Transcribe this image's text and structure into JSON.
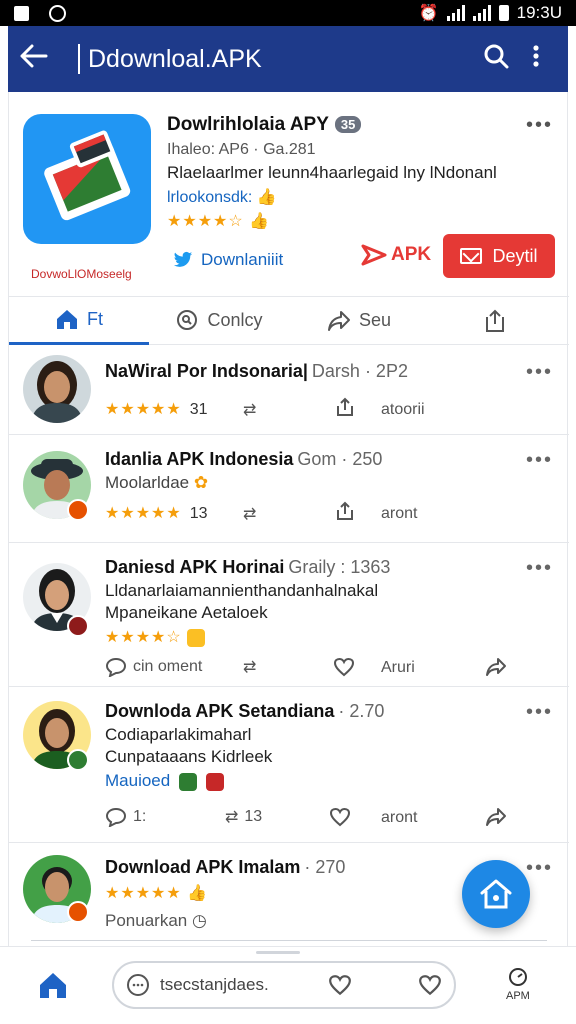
{
  "status_bar": {
    "time": "19:3U"
  },
  "app_bar": {
    "title": "Ddownloal.APK"
  },
  "app_card": {
    "name": "Dowlrihlolaia APY",
    "version_pill": "35",
    "meta": "Ihaleo: AP6 · Ga.281",
    "description": "Rlaelaarlmer leunn4haarlegaid lny lNdonanl",
    "developer": "lrlookonsdk:",
    "rating_stars": "★★★★☆",
    "logo_label": "DovwoLlOMoseelg",
    "twitter_label": "Downlaniiit",
    "apk_label": "APK",
    "deyti_label": "Deytil"
  },
  "tabs": [
    {
      "label": "Ft"
    },
    {
      "label": "Conlcy"
    },
    {
      "label": "Seu"
    },
    {
      "label": ""
    }
  ],
  "posts": [
    {
      "title": "NaWiral Por Indsonaria|",
      "time": "Darsh · 2P2",
      "stars": "★★★★★",
      "count": "31",
      "action3": "atoorii"
    },
    {
      "title": "Idanlia APK Indonesia",
      "time": "Gom · 250",
      "line1": "Moolarldae",
      "stars": "★★★★★",
      "count": "13",
      "action3": "aront"
    },
    {
      "title": "Daniesd APK Horinai",
      "time": "Graily : 1363",
      "line1": "Lldanarlaiamannienthandanhalnakal",
      "line2": "Mpaneikane Aetaloek",
      "stars": "★★★★☆",
      "comment": "cin oment",
      "action3": "Aruri"
    },
    {
      "title": "Downloda APK Setandiana",
      "time": "· 2.70",
      "line1": "Codiaparlakimaharl",
      "line2": "Cunpataaans Kidrleek",
      "line3": "Mauioed",
      "comment": "1:",
      "repost": "13",
      "action3": "aront"
    },
    {
      "title": "Download APK Imalam",
      "time": "· 270",
      "stars": "★★★★★",
      "line1": "Ponuarkan"
    }
  ],
  "bottom_bar": {
    "search_text": "tsecstanjdaes.",
    "apm_label": "APM"
  },
  "colors": {
    "app_bar": "#1e3a8a",
    "accent_red": "#e53935",
    "link_blue": "#1565c0",
    "star": "#f59e0b",
    "fab": "#1e88e5"
  }
}
